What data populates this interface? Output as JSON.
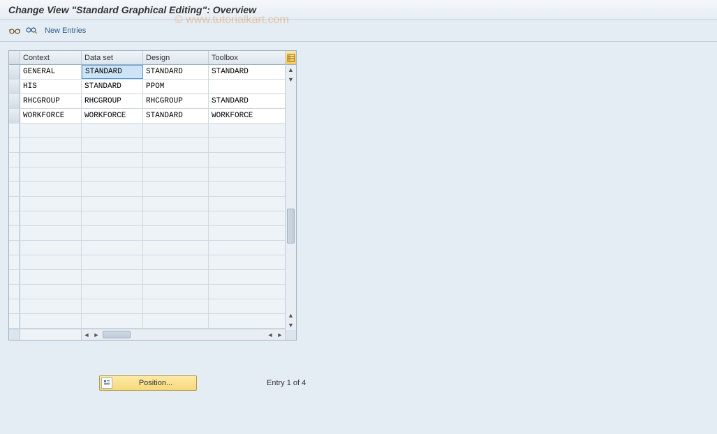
{
  "window": {
    "title": "Change View \"Standard Graphical Editing\": Overview"
  },
  "toolbar": {
    "new_entries_label": "New Entries"
  },
  "watermark": "© www.tutorialkart.com",
  "table": {
    "headers": {
      "context": "Context",
      "dataset": "Data set",
      "design": "Design",
      "toolbox": "Toolbox"
    },
    "rows": [
      {
        "context": "GENERAL",
        "dataset": "STANDARD",
        "design": "STANDARD",
        "toolbox": "STANDARD"
      },
      {
        "context": "HIS",
        "dataset": "STANDARD",
        "design": "PPOM",
        "toolbox": ""
      },
      {
        "context": "RHCGROUP",
        "dataset": "RHCGROUP",
        "design": "RHCGROUP",
        "toolbox": "STANDARD"
      },
      {
        "context": "WORKFORCE",
        "dataset": "WORKFORCE",
        "design": "STANDARD",
        "toolbox": "WORKFORCE"
      }
    ]
  },
  "footer": {
    "position_label": "Position...",
    "entry_text": "Entry 1 of 4"
  }
}
